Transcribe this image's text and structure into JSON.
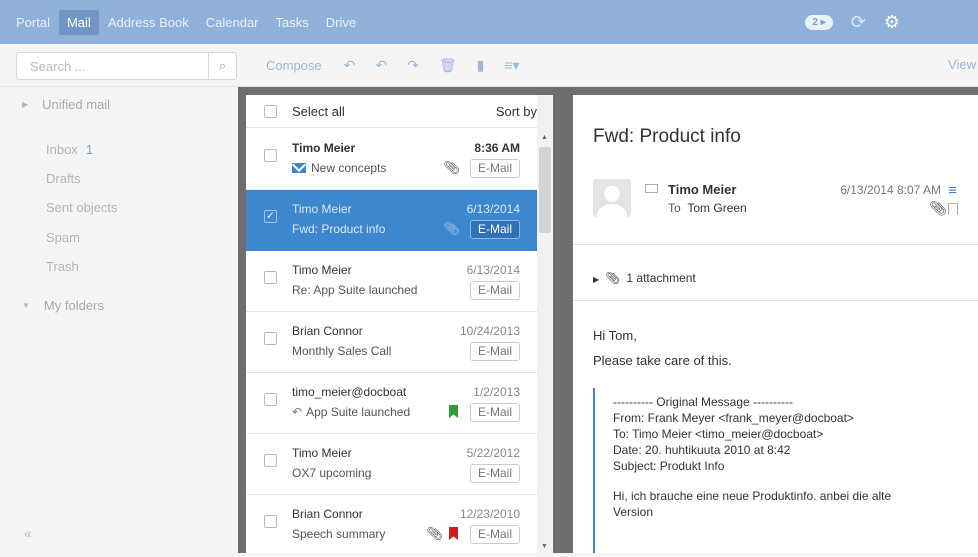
{
  "topnav": {
    "apps": [
      "Portal",
      "Mail",
      "Address Book",
      "Calendar",
      "Tasks",
      "Drive"
    ],
    "active_index": 1,
    "badge": "2 ▸"
  },
  "toolbar": {
    "search_placeholder": "Search ...",
    "compose_label": "Compose",
    "view_label": "View"
  },
  "sidebar": {
    "unified_label": "Unified mail",
    "folders": [
      {
        "label": "Inbox",
        "count": "1"
      },
      {
        "label": "Drafts",
        "count": ""
      },
      {
        "label": "Sent objects",
        "count": ""
      },
      {
        "label": "Spam",
        "count": ""
      },
      {
        "label": "Trash",
        "count": ""
      }
    ],
    "my_folders_label": "My folders",
    "collapse_label": "«"
  },
  "list": {
    "select_all_label": "Select all",
    "sort_label": "Sort by",
    "messages": [
      {
        "from": "Timo Meier",
        "date": "8:36 AM",
        "subject": "New concepts",
        "tag": "E-Mail"
      },
      {
        "from": "Timo Meier",
        "date": "6/13/2014",
        "subject": "Fwd: Product info",
        "tag": "E-Mail"
      },
      {
        "from": "Timo Meier",
        "date": "6/13/2014",
        "subject": "Re: App Suite launched",
        "tag": "E-Mail"
      },
      {
        "from": "Brian Connor",
        "date": "10/24/2013",
        "subject": "Monthly Sales Call",
        "tag": "E-Mail"
      },
      {
        "from": "timo_meier@docboat",
        "date": "1/2/2013",
        "subject": "App Suite launched",
        "tag": "E-Mail"
      },
      {
        "from": "Timo Meier",
        "date": "5/22/2012",
        "subject": "OX7 upcoming",
        "tag": "E-Mail"
      },
      {
        "from": "Brian Connor",
        "date": "12/23/2010",
        "subject": "Speech summary",
        "tag": "E-Mail"
      }
    ]
  },
  "detail": {
    "subject": "Fwd: Product info",
    "sender": "Timo Meier",
    "to_prefix": "To",
    "to_name": "Tom Green",
    "date": "6/13/2014 8:07 AM",
    "attachments_label": "1 attachment",
    "greeting": "Hi Tom,",
    "body": "Please take care of this.",
    "quote": {
      "header": "---------- Original Message ----------",
      "from": "From: Frank Meyer <frank_meyer@docboat>",
      "to": "To: Timo Meier <timo_meier@docboat>",
      "date": "Date: 20. huhtikuuta 2010 at 8:42",
      "subject": "Subject: Produkt Info",
      "text_line1": "Hi, ich brauche eine neue Produktinfo. anbei die alte",
      "text_line2": "Version"
    }
  },
  "colors": {
    "topbar": "#8fb0d8",
    "accent": "#3d87ce",
    "selected_row": "#3d87ce",
    "flag_green": "#2e9d3a",
    "flag_red": "#d01e1e"
  }
}
